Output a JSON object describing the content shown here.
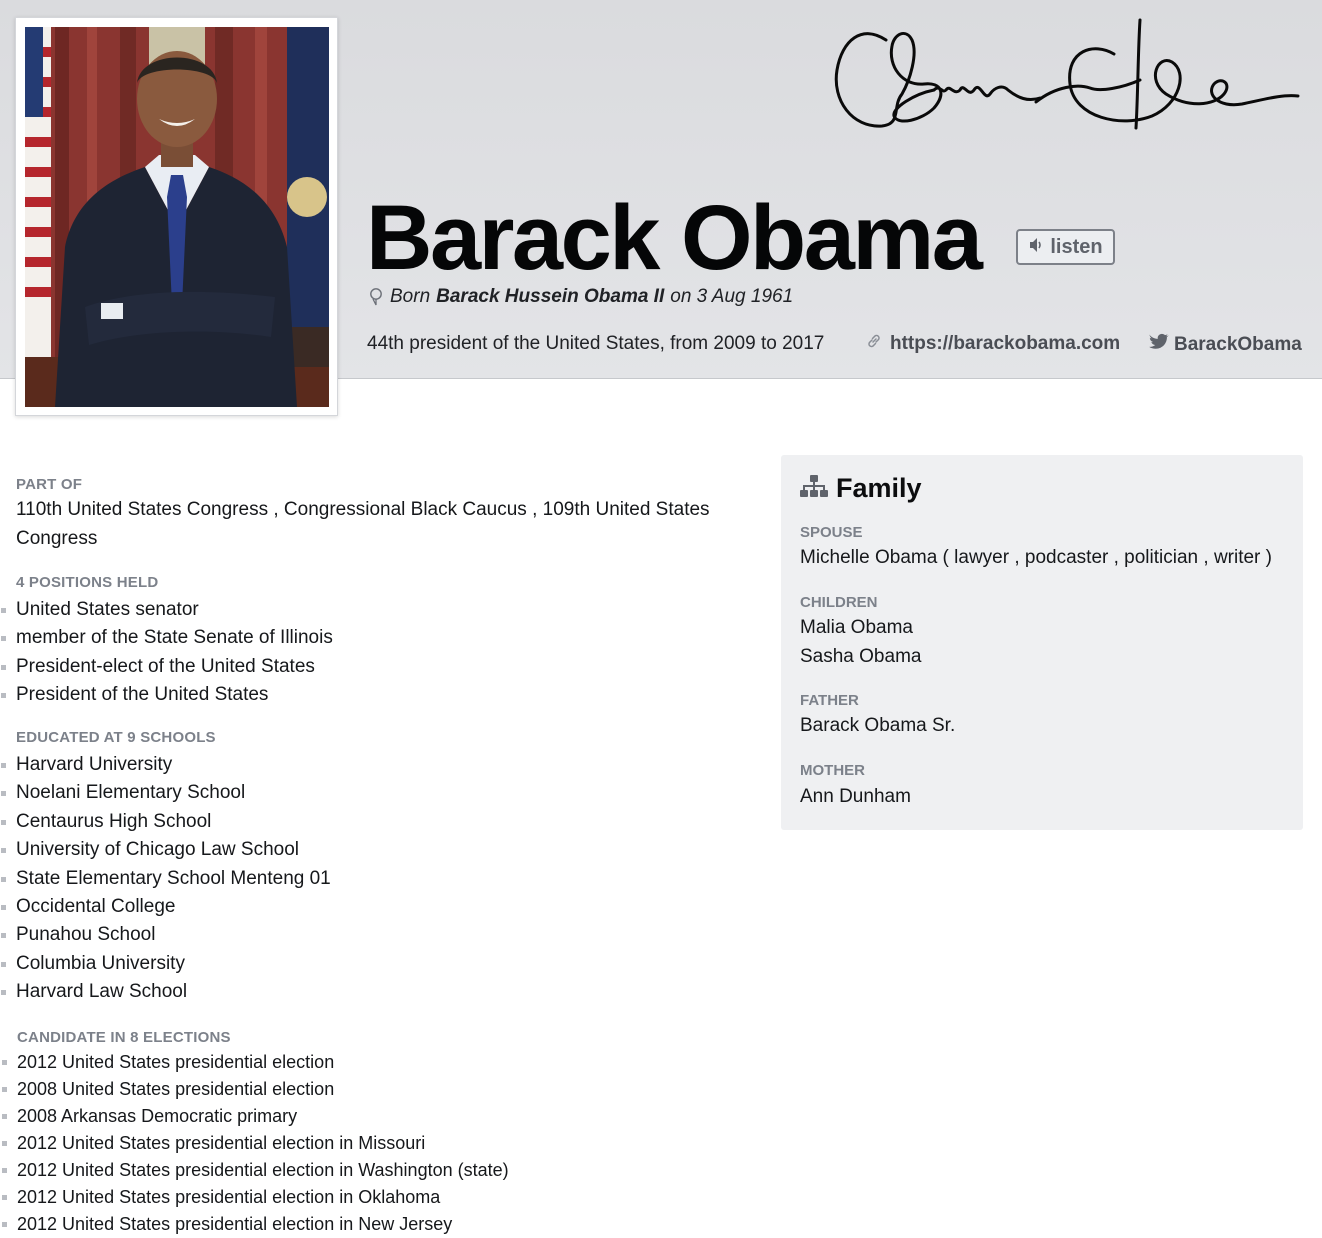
{
  "person": {
    "name": "Barack Obama",
    "listen_label": "listen",
    "born_prefix": "Born",
    "birth_name": "Barack Hussein Obama II",
    "born_on": "on 3 Aug 1961",
    "description": "44th president of the United States, from 2009 to 2017",
    "website": "https://barackobama.com",
    "twitter": "BarackObama"
  },
  "icons": {
    "listen": "speaker-icon",
    "born": "location-pin-icon",
    "website": "link-icon",
    "twitter": "twitter-bird-icon",
    "family": "family-tree-icon"
  },
  "part_of": {
    "label": "PART OF",
    "line1": "110th United States Congress , Congressional Black Caucus , 109th United States",
    "line2": "Congress"
  },
  "positions": {
    "label": "4 POSITIONS HELD",
    "items": [
      "United States senator",
      "member of the State Senate of Illinois",
      "President-elect of the United States",
      "President of the United States"
    ]
  },
  "education": {
    "label": "EDUCATED AT 9 SCHOOLS",
    "items": [
      "Harvard University",
      "Noelani Elementary School",
      "Centaurus High School",
      "University of Chicago Law School",
      "State Elementary School Menteng 01",
      "Occidental College",
      "Punahou School",
      "Columbia University",
      "Harvard Law School"
    ]
  },
  "elections": {
    "label": "CANDIDATE IN 8 ELECTIONS",
    "items": [
      "2012 United States presidential election",
      "2008 United States presidential election",
      "2008 Arkansas Democratic primary",
      "2012 United States presidential election in Missouri",
      "2012 United States presidential election in Washington (state)",
      "2012 United States presidential election in Oklahoma",
      "2012 United States presidential election in New Jersey"
    ]
  },
  "family": {
    "title": "Family",
    "spouse_label": "SPOUSE",
    "spouse": "Michelle Obama ( lawyer , podcaster , politician , writer )",
    "children_label": "CHILDREN",
    "children": [
      "Malia Obama",
      "Sasha Obama"
    ],
    "father_label": "FATHER",
    "father": "Barack Obama Sr.",
    "mother_label": "MOTHER",
    "mother": "Ann Dunham"
  },
  "colors": {
    "header_bg": "#dcdde0",
    "label_gray": "#7c818a",
    "card_bg": "#eff0f2"
  }
}
